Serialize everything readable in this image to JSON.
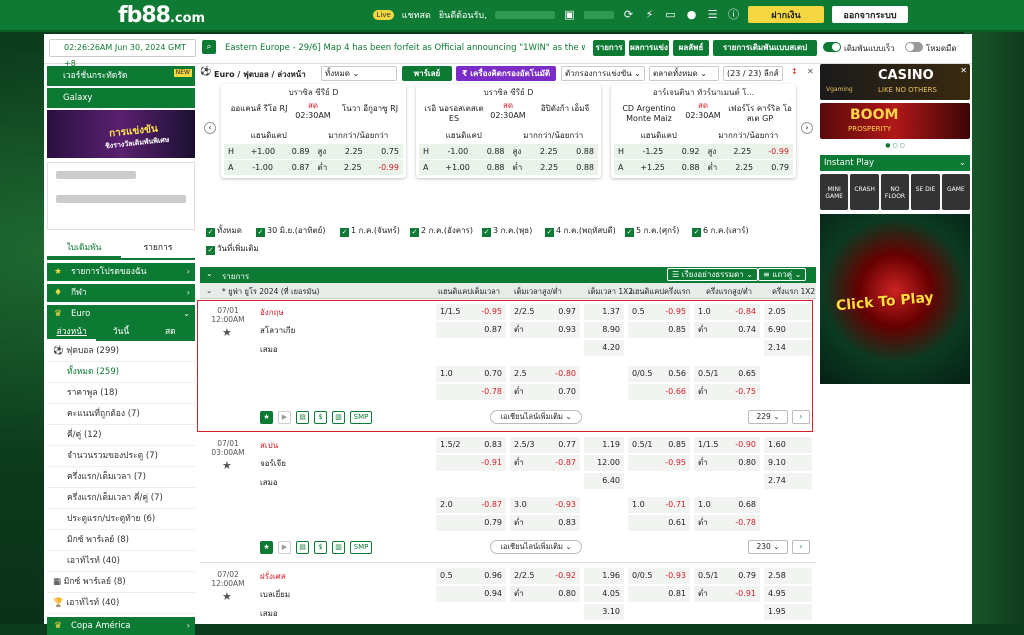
{
  "header": {
    "logo_main": "fb88",
    "logo_suffix": ".com",
    "chat_badge": "Live",
    "chat_label": "แชทสด",
    "welcome": "ยินดีต้อนรับ,",
    "deposit_label": "ฝากเงิน",
    "logout_label": "ออกจากระบบ"
  },
  "infobar": {
    "clock": "02:26:26AM Jun 30, 2024 GMT +8",
    "marquee": "Eastern Europe - 29/6] Map 4 has been forfeit as Official announcing \"1WIN\" as the winner.",
    "btn_list": "รายการ",
    "btn_results": "ผลการแข่ง",
    "btn_settlement": "ผลลัพธ์",
    "btn_bet_list": "รายการเดิมพันแบบสเตป",
    "toggle_quick": "เดิมพันแบบเร็ว",
    "toggle_dark": "โหมดมืด"
  },
  "sidebar": {
    "banner1": "เวอร์ชั่นกระทัดรัด",
    "banner1_badge": "NEW",
    "banner2": "Galaxy",
    "promo_text": "การแข่งขัน",
    "promo_sub": "ชิงรางวัลเดิมพันพิเศษ",
    "tab_bet": "ใบเดิมพัน",
    "tab_list": "รายการ",
    "sec_fav": "รายการโปรดของฉัน",
    "sec_sport": "กีฬา",
    "sec_euro": "Euro",
    "time_tabs": [
      "ล่วงหน้า",
      "วันนี้",
      "สด"
    ],
    "football": "ฟุตบอล (299)",
    "items": [
      "ทั้งหมด (259)",
      "ราคาพูล (18)",
      "คะแนนที่ถูกต้อง (7)",
      "คี่/คู่ (12)",
      "จำนวนรวมของประตู (7)",
      "ครึ่งแรก/เต็มเวลา (7)",
      "ครึ่งแรก/เต็มเวลา คี่/คู่ (7)",
      "ประตูแรก/ประตูท้าย (6)",
      "มิกซ์ พาร์เลย์ (8)",
      "เอาท์ไรท์ (40)"
    ],
    "mix": "มิกซ์ พาร์เลย์ (8)",
    "outright": "เอาท์ไรท์ (40)",
    "copa": "Copa América"
  },
  "filters": {
    "title": "Euro / ฟุตบอล / ล่วงหน้า",
    "dropdown": "ทั้งหมด",
    "parlay": "พาร์เลย์",
    "calc": "₹ เครื่องคิดกรองอัตโนมัติ",
    "sort": "ตัวกรองการแข่งขัน",
    "market": "ตลาดทั้งหมด",
    "count": "(23 / 23) ลีกส์"
  },
  "cards": [
    {
      "league": "บราซิล ซีรีย์ D",
      "home": "ออแคนส์ รีโอ RJ",
      "away": "โนวา อีกูอาซู RJ",
      "status": "สด",
      "time": "02:30AM",
      "hcap": "แฮนดิแคป",
      "ou": "มากกว่า/น้อยกว่า",
      "r1": [
        "H",
        "+1.00",
        "0.89",
        "สูง",
        "2.25",
        "0.75"
      ],
      "r2": [
        "A",
        "-1.00",
        "0.87",
        "ต่ำ",
        "2.25",
        "-0.99"
      ]
    },
    {
      "league": "บราซิล ซีรีย์ D",
      "home": "เรอิ นอรอสเตสเต ES",
      "away": "อิปิตังก้า เอ็มจี",
      "status": "สด",
      "time": "02:30AM",
      "hcap": "แฮนดิแคป",
      "ou": "มากกว่า/น้อยกว่า",
      "r1": [
        "H",
        "-1.00",
        "0.88",
        "สูง",
        "2.25",
        "0.88"
      ],
      "r2": [
        "A",
        "+1.00",
        "0.88",
        "ต่ำ",
        "2.25",
        "0.88"
      ]
    },
    {
      "league": "อาร์เจนตินา ทัวร์นาเมนต์ โ...",
      "home": "CD Argentino Monte Maiz",
      "away": "เฟอร์โร คาร์ริล โอ สเต GP",
      "status": "สด",
      "time": "02:30AM",
      "hcap": "แฮนดิแคป",
      "ou": "มากกว่า/น้อยกว่า",
      "r1": [
        "H",
        "-1.25",
        "0.92",
        "สูง",
        "2.25",
        "-0.99"
      ],
      "r2": [
        "A",
        "+1.25",
        "0.88",
        "ต่ำ",
        "2.25",
        "0.79"
      ]
    }
  ],
  "date_filters": [
    "ทั้งหมด",
    "30 มิ.ย.(อาทิตย์)",
    "1 ก.ค.(จันทร์)",
    "2 ก.ค.(อังคาร)",
    "3 ก.ค.(พุธ)",
    "4 ก.ค.(พฤหัสบดี)",
    "5 ก.ค.(ศุกร์)",
    "6 ก.ค.(เสาร์)",
    "วันที่เพิ่มเติม"
  ],
  "table": {
    "head_list": "รายการ",
    "head_sort": "เรียงอย่างธรรมดา",
    "head_view": "แถวคู่",
    "league": "ยูฟ่า ยูโร 2024 (ที่ เยอรมัน)",
    "cols": [
      "แฮนดิแคปเต็มเวลา",
      "เต็มเวลาสูง/ต่ำ",
      "เต็มเวลา 1X2",
      "แฮนดิแคปครึ่งแรก",
      "ครึ่งแรกสูง/ต่ำ",
      "ครึ่งแรก 1X2"
    ],
    "more": "เอเชียนไลน์เพิ่มเติม",
    "smp": "SMP",
    "matches": [
      {
        "date": "07/01",
        "time": "12:00AM",
        "home": "อังกฤษ",
        "away": "สโลวาเกีย",
        "draw": "เสมอ",
        "more_count": "229",
        "r1": [
          "1/1.5",
          "-0.95",
          "2/2.5",
          "0.97",
          "1.37",
          "0.5",
          "-0.95",
          "1.0",
          "-0.84",
          "2.05"
        ],
        "r2": [
          "",
          "0.87",
          "ต่ำ",
          "0.93",
          "8.90",
          "",
          "0.85",
          "ต่ำ",
          "0.74",
          "6.90"
        ],
        "r3": [
          "4.20",
          "2.14"
        ],
        "r4": [
          "1.0",
          "0.70",
          "2.5",
          "-0.80",
          "0/0.5",
          "0.56",
          "0.5/1",
          "0.65"
        ],
        "r5": [
          "",
          "-0.78",
          "ต่ำ",
          "0.70",
          "",
          "-0.66",
          "ต่ำ",
          "-0.75"
        ]
      },
      {
        "date": "07/01",
        "time": "03:00AM",
        "home": "สเปน",
        "away": "จอร์เจีย",
        "draw": "เสมอ",
        "more_count": "230",
        "r1": [
          "1.5/2",
          "0.83",
          "2.5/3",
          "0.77",
          "1.19",
          "0.5/1",
          "0.85",
          "1/1.5",
          "-0.90",
          "1.60"
        ],
        "r2": [
          "",
          "-0.91",
          "ต่ำ",
          "-0.87",
          "12.00",
          "",
          "-0.95",
          "ต่ำ",
          "0.80",
          "9.10"
        ],
        "r3": [
          "6.40",
          "2.74"
        ],
        "r4": [
          "2.0",
          "-0.87",
          "3.0",
          "-0.93",
          "1.0",
          "-0.71",
          "1.0",
          "0.68"
        ],
        "r5": [
          "",
          "0.79",
          "ต่ำ",
          "0.83",
          "",
          "0.61",
          "ต่ำ",
          "-0.78"
        ]
      },
      {
        "date": "07/02",
        "time": "12:00AM",
        "home": "ฝรั่งเศส",
        "away": "เบลเยี่ยม",
        "draw": "เสมอ",
        "more_count": "",
        "r1": [
          "0.5",
          "0.96",
          "2/2.5",
          "-0.92",
          "1.96",
          "0/0.5",
          "-0.93",
          "0.5/1",
          "0.79",
          "2.58"
        ],
        "r2": [
          "",
          "0.94",
          "ต่ำ",
          "0.80",
          "4.05",
          "",
          "0.81",
          "ต่ำ",
          "-0.91",
          "4.95"
        ],
        "r3": [
          "3.10",
          "1.95"
        ],
        "r4": [
          "0.5/1",
          "-0.81",
          "2.0",
          "0.73",
          "0",
          "0.46",
          "1.0",
          "-0.73"
        ],
        "r5": [
          "",
          "",
          "",
          "",
          "",
          "",
          "",
          ""
        ]
      }
    ]
  },
  "right": {
    "casino": "CASINO",
    "casino_sub": "LIKE NO OTHERS",
    "vgaming": "Vgaming",
    "boom": "BOOM",
    "boom_sub": "PROSPERITY",
    "instant": "Instant Play",
    "games": [
      "MINI GAME",
      "CRASH",
      "NO FLOOR",
      "SE DIE",
      "GAME"
    ],
    "click": "Click To Play"
  },
  "colors": {
    "brand": "#0d7a33",
    "accent": "#f5d742",
    "red": "#d5202a"
  }
}
